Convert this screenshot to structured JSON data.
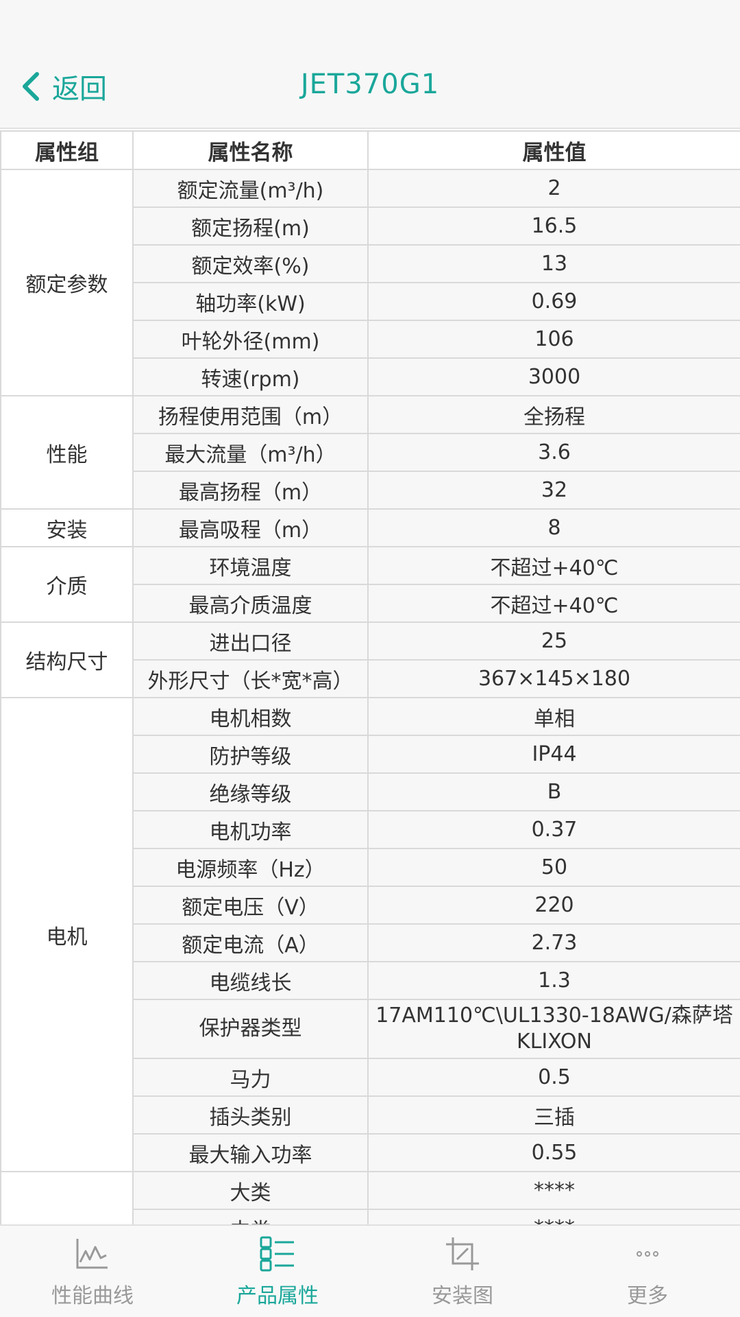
{
  "header": {
    "back_label": "返回",
    "title": "JET370G1"
  },
  "table": {
    "columns": [
      "属性组",
      "属性名称",
      "属性值"
    ],
    "rows": [
      {
        "name": "额定流量(m³/h)",
        "value": "2"
      },
      {
        "name": "额定扬程(m)",
        "value": "16.5"
      },
      {
        "name": "额定效率(%)",
        "value": "13"
      },
      {
        "name": "轴功率(kW)",
        "value": "0.69"
      },
      {
        "name": "叶轮外径(mm)",
        "value": "106"
      },
      {
        "name": "转速(rpm)",
        "value": "3000"
      },
      {
        "name": "扬程使用范围（m）",
        "value": "全扬程"
      },
      {
        "name": "最大流量（m³/h）",
        "value": "3.6"
      },
      {
        "name": "最高扬程（m）",
        "value": "32"
      },
      {
        "name": "最高吸程（m）",
        "value": "8"
      },
      {
        "name": "环境温度",
        "value": "不超过+40℃"
      },
      {
        "name": "最高介质温度",
        "value": "不超过+40℃"
      },
      {
        "name": "进出口径",
        "value": "25"
      },
      {
        "name": "外形尺寸（长*宽*高）",
        "value": "367×145×180"
      },
      {
        "name": "电机相数",
        "value": "单相"
      },
      {
        "name": "防护等级",
        "value": "IP44"
      },
      {
        "name": "绝缘等级",
        "value": "B"
      },
      {
        "name": "电机功率",
        "value": "0.37"
      },
      {
        "name": "电源频率（Hz）",
        "value": "50"
      },
      {
        "name": "额定电压（V）",
        "value": "220"
      },
      {
        "name": "额定电流（A）",
        "value": "2.73"
      },
      {
        "name": "电缆线长",
        "value": "1.3"
      },
      {
        "name": "保护器类型",
        "value": "17AM110℃\\UL1330-18AWG/森萨塔KLIXON"
      },
      {
        "name": "马力",
        "value": "0.5"
      },
      {
        "name": "插头类别",
        "value": "三插"
      },
      {
        "name": "最大输入功率",
        "value": "0.55"
      },
      {
        "name": "大类",
        "value": "****"
      },
      {
        "name": "中类",
        "value": "****"
      }
    ],
    "groups": [
      "额定参数",
      "性能",
      "安装",
      "介质",
      "结构尺寸",
      "电机",
      ""
    ]
  },
  "tabbar": {
    "tabs": [
      {
        "label": "性能曲线",
        "icon": "line-chart-icon"
      },
      {
        "label": "产品属性",
        "icon": "list-icon"
      },
      {
        "label": "安装图",
        "icon": "crop-icon"
      },
      {
        "label": "更多",
        "icon": "more-icon"
      }
    ],
    "active_color": "#1aa79a",
    "inactive_color": "#999999"
  }
}
